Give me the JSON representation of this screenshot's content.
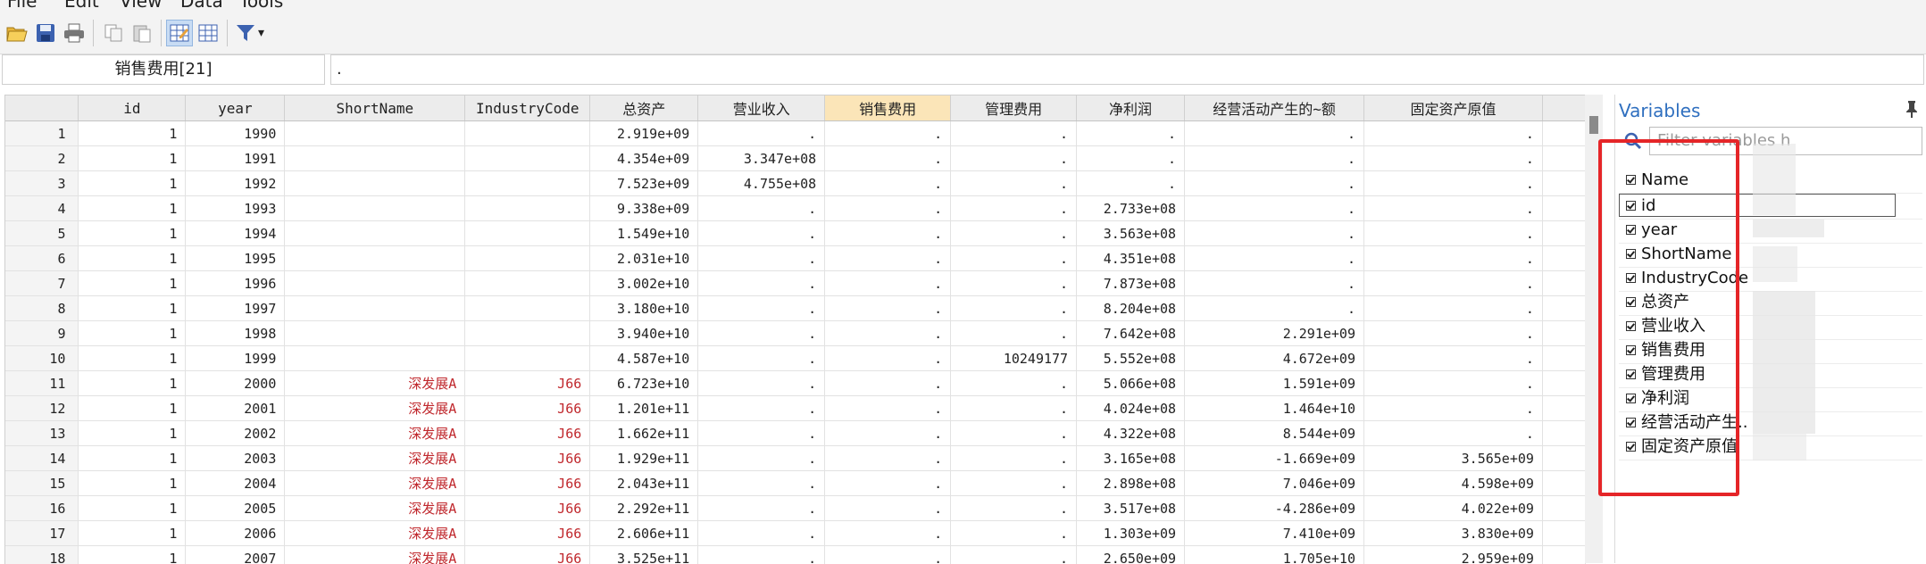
{
  "menu": [
    "File",
    "Edit",
    "View",
    "Data",
    "Tools"
  ],
  "toolbar": {
    "icons": [
      "open-icon",
      "save-icon",
      "print-icon",
      "copy-icon",
      "paste-icon",
      "edit-mode-icon",
      "browse-mode-icon",
      "filter-icon"
    ],
    "filter_dropdown": "▾"
  },
  "namebox": "销售费用[21]",
  "valuebox": ".",
  "grid": {
    "columns": [
      "id",
      "year",
      "ShortName",
      "IndustryCode",
      "总资产",
      "营业收入",
      "销售费用",
      "管理费用",
      "净利润",
      "经营活动产生的~额",
      "固定资产原值"
    ],
    "selected_column": "销售费用",
    "rows": [
      [
        "1",
        "1",
        "1990",
        "",
        "",
        "2.919e+09",
        ".",
        ".",
        ".",
        ".",
        ".",
        "."
      ],
      [
        "2",
        "1",
        "1991",
        "",
        "",
        "4.354e+09",
        "3.347e+08",
        ".",
        ".",
        ".",
        ".",
        "."
      ],
      [
        "3",
        "1",
        "1992",
        "",
        "",
        "7.523e+09",
        "4.755e+08",
        ".",
        ".",
        ".",
        ".",
        "."
      ],
      [
        "4",
        "1",
        "1993",
        "",
        "",
        "9.338e+09",
        ".",
        ".",
        ".",
        "2.733e+08",
        ".",
        "."
      ],
      [
        "5",
        "1",
        "1994",
        "",
        "",
        "1.549e+10",
        ".",
        ".",
        ".",
        "3.563e+08",
        ".",
        "."
      ],
      [
        "6",
        "1",
        "1995",
        "",
        "",
        "2.031e+10",
        ".",
        ".",
        ".",
        "4.351e+08",
        ".",
        "."
      ],
      [
        "7",
        "1",
        "1996",
        "",
        "",
        "3.002e+10",
        ".",
        ".",
        ".",
        "7.873e+08",
        ".",
        "."
      ],
      [
        "8",
        "1",
        "1997",
        "",
        "",
        "3.180e+10",
        ".",
        ".",
        ".",
        "8.204e+08",
        ".",
        "."
      ],
      [
        "9",
        "1",
        "1998",
        "",
        "",
        "3.940e+10",
        ".",
        ".",
        ".",
        "7.642e+08",
        "2.291e+09",
        "."
      ],
      [
        "10",
        "1",
        "1999",
        "",
        "",
        "4.587e+10",
        ".",
        ".",
        "10249177",
        "5.552e+08",
        "4.672e+09",
        "."
      ],
      [
        "11",
        "1",
        "2000",
        "深发展A",
        "J66",
        "6.723e+10",
        ".",
        ".",
        ".",
        "5.066e+08",
        "1.591e+09",
        "."
      ],
      [
        "12",
        "1",
        "2001",
        "深发展A",
        "J66",
        "1.201e+11",
        ".",
        ".",
        ".",
        "4.024e+08",
        "1.464e+10",
        "."
      ],
      [
        "13",
        "1",
        "2002",
        "深发展A",
        "J66",
        "1.662e+11",
        ".",
        ".",
        ".",
        "4.322e+08",
        "8.544e+09",
        "."
      ],
      [
        "14",
        "1",
        "2003",
        "深发展A",
        "J66",
        "1.929e+11",
        ".",
        ".",
        ".",
        "3.165e+08",
        "-1.669e+09",
        "3.565e+09"
      ],
      [
        "15",
        "1",
        "2004",
        "深发展A",
        "J66",
        "2.043e+11",
        ".",
        ".",
        ".",
        "2.898e+08",
        "7.046e+09",
        "4.598e+09"
      ],
      [
        "16",
        "1",
        "2005",
        "深发展A",
        "J66",
        "2.292e+11",
        ".",
        ".",
        ".",
        "3.517e+08",
        "-4.286e+09",
        "4.022e+09"
      ],
      [
        "17",
        "1",
        "2006",
        "深发展A",
        "J66",
        "2.606e+11",
        ".",
        ".",
        ".",
        "1.303e+09",
        "7.410e+09",
        "3.830e+09"
      ],
      [
        "18",
        "1",
        "2007",
        "深发展A",
        "J66",
        "3.525e+11",
        ".",
        ".",
        ".",
        "2.650e+09",
        "1.705e+10",
        "2.959e+09"
      ]
    ]
  },
  "variables_panel": {
    "title": "Variables",
    "pin": "📌",
    "filter_placeholder": "Filter variables h",
    "header": "Name",
    "names": [
      "id",
      "year",
      "ShortName",
      "IndustryCode",
      "总资产",
      "营业收入",
      "销售费用",
      "管理费用",
      "净利润",
      "经营活动产生..",
      "固定资产原值"
    ]
  },
  "colors": {
    "accent": "#2f6fbf",
    "string_values": "#c0282d",
    "highlight_box": "#e52528",
    "selected_header": "#fbe5b8"
  }
}
